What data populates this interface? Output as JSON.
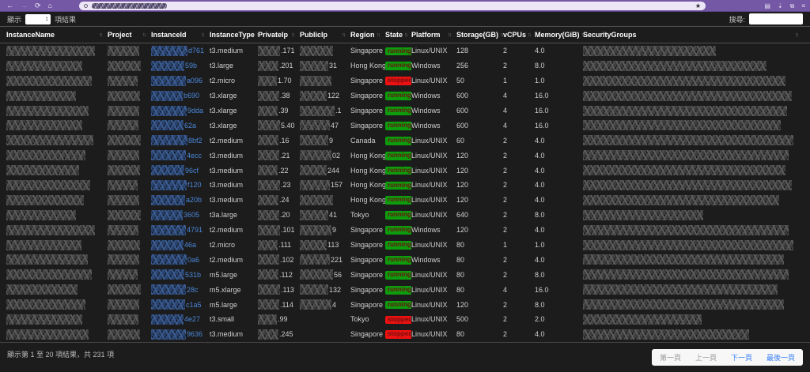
{
  "browser": {
    "icons": {
      "back": "←",
      "forward": "→",
      "reload": "⟳",
      "home": "⌂",
      "bookmark_star": "★",
      "panel": "▤",
      "download": "⇣",
      "window": "⧉",
      "menu": "≡",
      "select_spinner": "↕",
      "sort": "↑↓",
      "address_circle": "circle"
    }
  },
  "controls": {
    "show_label": "顯示",
    "results_label": "項結果",
    "length_value": "",
    "search_label": "搜尋:",
    "search_value": ""
  },
  "table": {
    "columns": [
      "InstanceName",
      "Project",
      "InstanceId",
      "InstanceType",
      "PrivateIp",
      "PublicIp",
      "Region",
      "State",
      "Platform",
      "Storage(GB)",
      "vCPUs",
      "Memory(GiB)",
      "SecurityGroups"
    ],
    "rows": [
      {
        "id_suffix": "d761",
        "type": "t3.medium",
        "private_suffix": ".171",
        "public_suffix": "",
        "public_redacted": true,
        "region": "Singapore",
        "state": "running",
        "platform": "Linux/UNIX",
        "storage": "128",
        "vcpus": "2",
        "memory": "4.0"
      },
      {
        "id_suffix": "59b",
        "type": "t3.large",
        "private_suffix": ".201",
        "public_suffix": "31",
        "public_redacted": true,
        "region": "Hong Kong",
        "state": "running",
        "platform": "Windows",
        "storage": "256",
        "vcpus": "2",
        "memory": "8.0"
      },
      {
        "id_suffix": "a096",
        "type": "t2.micro",
        "private_suffix": "1.70",
        "public_suffix": "",
        "public_redacted": true,
        "region": "Singapore",
        "state": "stopped",
        "platform": "Linux/UNIX",
        "storage": "50",
        "vcpus": "1",
        "memory": "1.0"
      },
      {
        "id_suffix": "b690",
        "type": "t3.xlarge",
        "private_suffix": ".38",
        "public_suffix": "122",
        "public_redacted": true,
        "region": "Singapore",
        "state": "running",
        "platform": "Windows",
        "storage": "600",
        "vcpus": "4",
        "memory": "16.0"
      },
      {
        "id_suffix": "9dda",
        "type": "t3.xlarge",
        "private_suffix": ".39",
        "public_suffix": ".1",
        "public_redacted": true,
        "region": "Singapore",
        "state": "running",
        "platform": "Windows",
        "storage": "600",
        "vcpus": "4",
        "memory": "16.0"
      },
      {
        "id_suffix": "62a",
        "type": "t3.xlarge",
        "private_suffix": "5.40",
        "public_suffix": "47",
        "public_redacted": true,
        "region": "Singapore",
        "state": "running",
        "platform": "Windows",
        "storage": "600",
        "vcpus": "4",
        "memory": "16.0"
      },
      {
        "id_suffix": "8bf2",
        "type": "t2.medium",
        "private_suffix": ".16",
        "public_suffix": "9",
        "public_redacted": true,
        "region": "Canada",
        "state": "running",
        "platform": "Linux/UNIX",
        "storage": "60",
        "vcpus": "2",
        "memory": "4.0"
      },
      {
        "id_suffix": "4ecc",
        "type": "t3.medium",
        "private_suffix": ".21",
        "public_suffix": "02",
        "public_redacted": true,
        "region": "Hong Kong",
        "state": "running",
        "platform": "Linux/UNIX",
        "storage": "120",
        "vcpus": "2",
        "memory": "4.0"
      },
      {
        "id_suffix": "96cf",
        "type": "t3.medium",
        "private_suffix": ".22",
        "public_suffix": "244",
        "public_redacted": true,
        "region": "Hong Kong",
        "state": "running",
        "platform": "Linux/UNIX",
        "storage": "120",
        "vcpus": "2",
        "memory": "4.0"
      },
      {
        "id_suffix": "f120",
        "type": "t3.medium",
        "private_suffix": ".23",
        "public_suffix": "157",
        "public_redacted": true,
        "region": "Hong Kong",
        "state": "running",
        "platform": "Linux/UNIX",
        "storage": "120",
        "vcpus": "2",
        "memory": "4.0"
      },
      {
        "id_suffix": "a20b",
        "type": "t3.medium",
        "private_suffix": ".24",
        "public_suffix": "",
        "public_redacted": true,
        "region": "Hong Kong",
        "state": "running",
        "platform": "Linux/UNIX",
        "storage": "120",
        "vcpus": "2",
        "memory": "4.0"
      },
      {
        "id_suffix": "3605",
        "type": "t3a.large",
        "private_suffix": ".20",
        "public_suffix": "41",
        "public_redacted": true,
        "region": "Tokyo",
        "state": "running",
        "platform": "Linux/UNIX",
        "storage": "640",
        "vcpus": "2",
        "memory": "8.0"
      },
      {
        "id_suffix": "4791",
        "type": "t2.medium",
        "private_suffix": ".101",
        "public_suffix": "9",
        "public_redacted": true,
        "region": "Singapore",
        "state": "running",
        "platform": "Windows",
        "storage": "120",
        "vcpus": "2",
        "memory": "4.0"
      },
      {
        "id_suffix": "46a",
        "type": "t2.micro",
        "private_suffix": ".111",
        "public_suffix": "113",
        "public_redacted": true,
        "region": "Singapore",
        "state": "running",
        "platform": "Linux/UNIX",
        "storage": "80",
        "vcpus": "1",
        "memory": "1.0"
      },
      {
        "id_suffix": "0a6",
        "type": "t2.medium",
        "private_suffix": ".102",
        "public_suffix": "221",
        "public_redacted": true,
        "region": "Singapore",
        "state": "running",
        "platform": "Windows",
        "storage": "80",
        "vcpus": "2",
        "memory": "4.0"
      },
      {
        "id_suffix": "531b",
        "type": "m5.large",
        "private_suffix": ".112",
        "public_suffix": "56",
        "public_redacted": true,
        "region": "Singapore",
        "state": "running",
        "platform": "Linux/UNIX",
        "storage": "80",
        "vcpus": "2",
        "memory": "8.0"
      },
      {
        "id_suffix": "28c",
        "type": "m5.xlarge",
        "private_suffix": ".113",
        "public_suffix": "132",
        "public_redacted": true,
        "region": "Singapore",
        "state": "running",
        "platform": "Linux/UNIX",
        "storage": "80",
        "vcpus": "4",
        "memory": "16.0"
      },
      {
        "id_suffix": "c1a5",
        "type": "m5.large",
        "private_suffix": ".114",
        "public_suffix": "4",
        "public_redacted": true,
        "region": "Singapore",
        "state": "running",
        "platform": "Linux/UNIX",
        "storage": "120",
        "vcpus": "2",
        "memory": "8.0"
      },
      {
        "id_suffix": "4e27",
        "type": "t3.small",
        "private_suffix": ".99",
        "public_suffix": "",
        "public_redacted": false,
        "region": "Tokyo",
        "state": "stopped",
        "platform": "Linux/UNIX",
        "storage": "500",
        "vcpus": "2",
        "memory": "2.0"
      },
      {
        "id_suffix": "9636",
        "type": "t3.medium",
        "private_suffix": ".245",
        "public_suffix": "",
        "public_redacted": false,
        "region": "Singapore",
        "state": "stopped",
        "platform": "Linux/UNIX",
        "storage": "80",
        "vcpus": "2",
        "memory": "4.0"
      }
    ]
  },
  "footer": {
    "info": "顯示第 1 至 20 項結果，共 231 項",
    "pagination": [
      {
        "label": "第一頁",
        "enabled": false
      },
      {
        "label": "上一頁",
        "enabled": false
      },
      {
        "label": "下一頁",
        "enabled": true
      },
      {
        "label": "最後一頁",
        "enabled": true
      }
    ]
  },
  "colors": {
    "toolbar_purple": "#7458a5",
    "address_bar": "#ece6f6",
    "page_bg": "#1c1c1c",
    "running_bg": "#0d9c0d",
    "stopped_bg": "#ee1111",
    "badge_text": "#6b1010",
    "link_blue": "#4a86d8",
    "pager_blue": "#3b82f6"
  }
}
